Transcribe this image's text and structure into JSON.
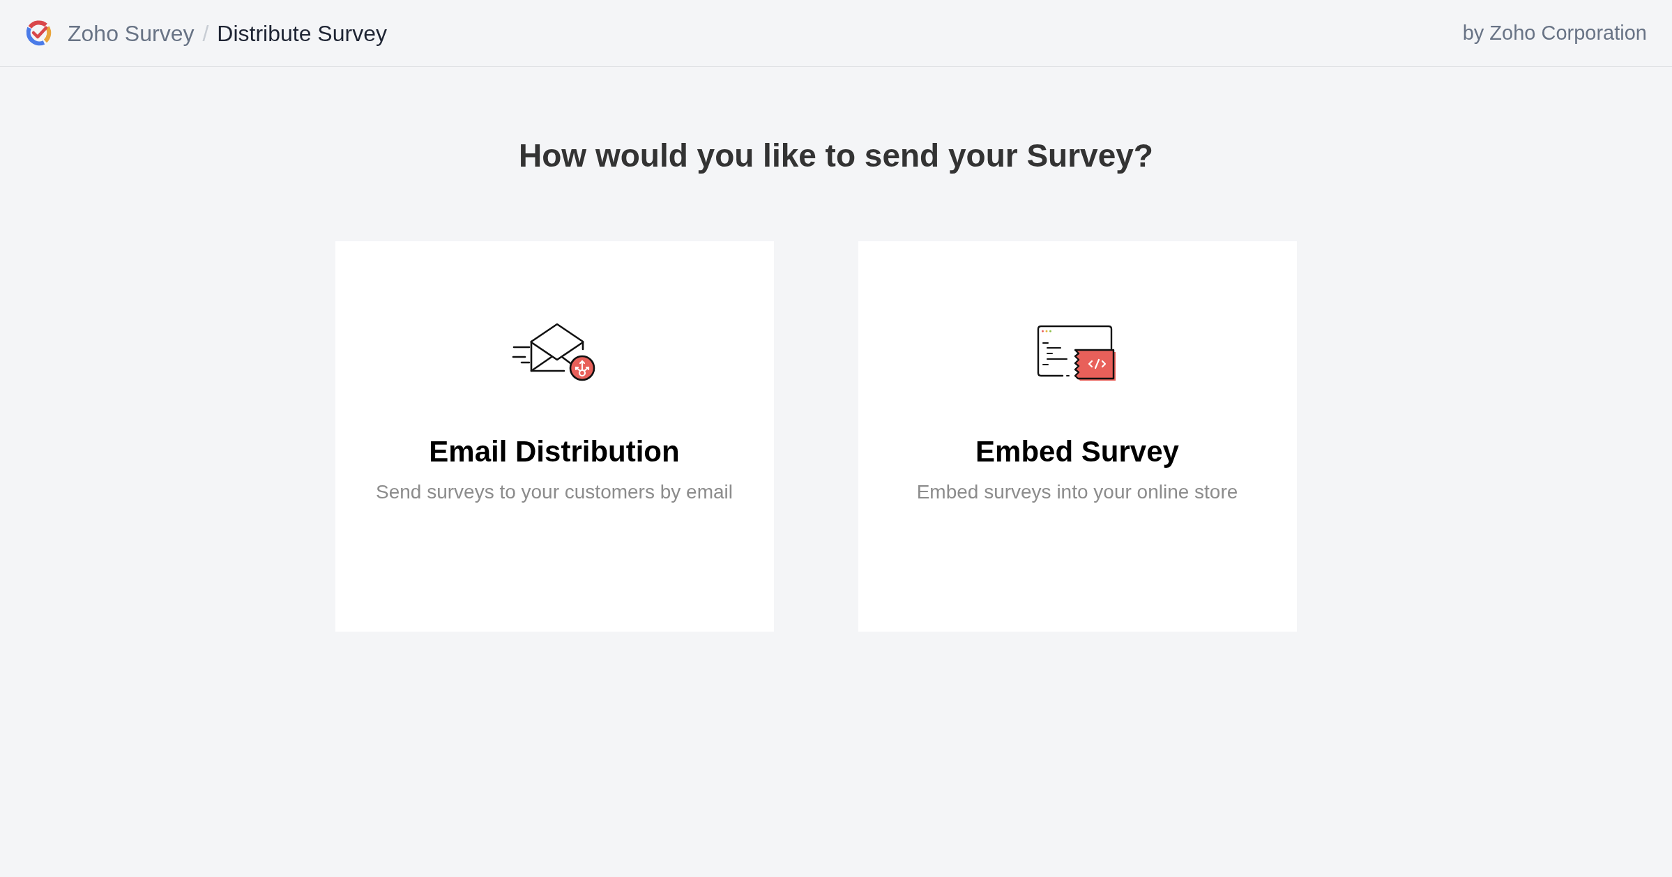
{
  "header": {
    "app_name": "Zoho Survey",
    "separator": "/",
    "page_title": "Distribute Survey",
    "vendor": "by Zoho Corporation"
  },
  "heading": "How would you like to send your Survey?",
  "options": [
    {
      "kind": "email",
      "title": "Email Distribution",
      "description": "Send surveys to your customers by email"
    },
    {
      "kind": "embed",
      "title": "Embed Survey",
      "description": "Embed surveys into your online store"
    }
  ]
}
